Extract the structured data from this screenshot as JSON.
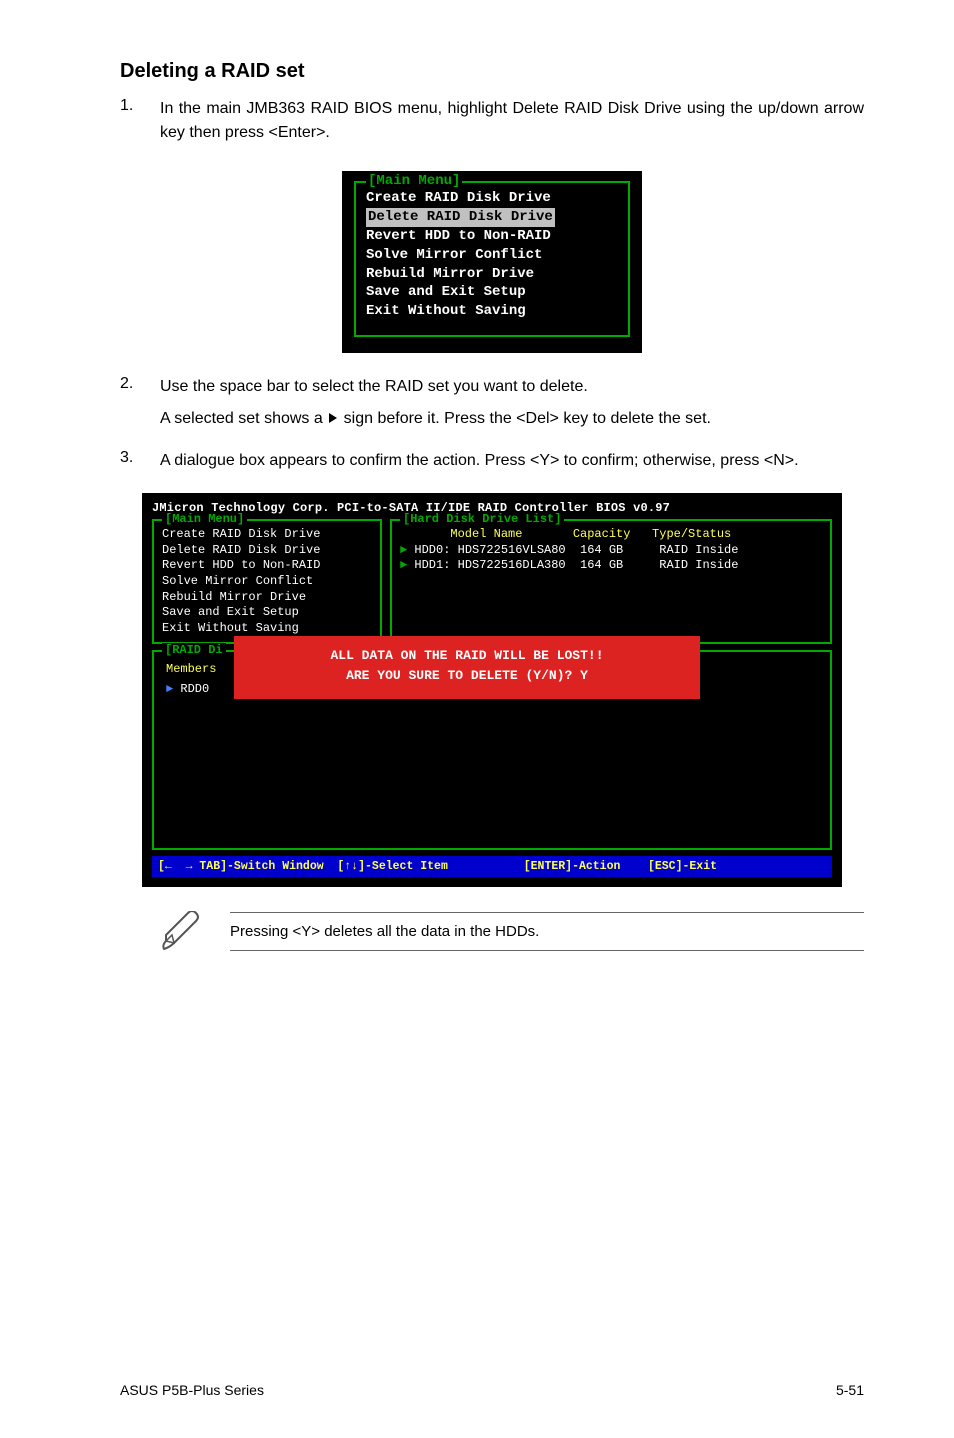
{
  "section_title": "Deleting a RAID set",
  "steps": {
    "s1_num": "1.",
    "s1_text": "In the main JMB363 RAID BIOS menu, highlight Delete RAID Disk Drive using the up/down arrow key then press <Enter>.",
    "s2_num": "2.",
    "s2_line1": "Use the space bar to select the RAID set you want to delete.",
    "s2_line2a": "A selected set shows a ",
    "s2_line2b": " sign before it. Press the <Del> key to delete the set.",
    "s3_num": "3.",
    "s3_text": "A dialogue box appears to confirm the action. Press <Y> to confirm; otherwise, press <N>."
  },
  "bios_small": {
    "title": "[Main Menu]",
    "items": [
      "Create RAID Disk Drive",
      "Delete RAID Disk Drive",
      "Revert HDD to Non-RAID",
      "Solve Mirror Conflict",
      "Rebuild Mirror Drive",
      "Save and Exit Setup",
      "Exit Without Saving"
    ],
    "selected_index": 1
  },
  "bios_large": {
    "header": "JMicron Technology Corp. PCI-to-SATA II/IDE RAID Controller BIOS v0.97",
    "main_menu_title": "[Main Menu]",
    "main_menu_items": [
      "Create RAID Disk Drive",
      "Delete RAID Disk Drive",
      "Revert HDD to Non-RAID",
      "Solve Mirror Conflict",
      "Rebuild Mirror Drive",
      "Save and Exit Setup",
      "Exit Without Saving"
    ],
    "hdd_title": "[Hard Disk Drive List]",
    "hdd_header": "       Model Name       Capacity   Type/Status",
    "hdd0": "HDD0: HDS722516VLSA80  164 GB     RAID Inside",
    "hdd1": "HDD1: HDS722516DLA380  164 GB     RAID Inside",
    "raid_title": "[RAID Di",
    "members_label": "Members",
    "rdd_label": "RDD0",
    "overlay_line1": "ALL DATA ON THE RAID WILL BE LOST!!",
    "overlay_line2": "ARE YOU SURE TO DELETE (Y/N)? Y",
    "footer_bar": "[←  → TAB]-Switch Window  [↑↓]-Select Item           [ENTER]-Action    [ESC]-Exit"
  },
  "note_text": "Pressing <Y> deletes all the data in the HDDs.",
  "footer": {
    "left": "ASUS P5B-Plus Series",
    "right": "5-51"
  }
}
